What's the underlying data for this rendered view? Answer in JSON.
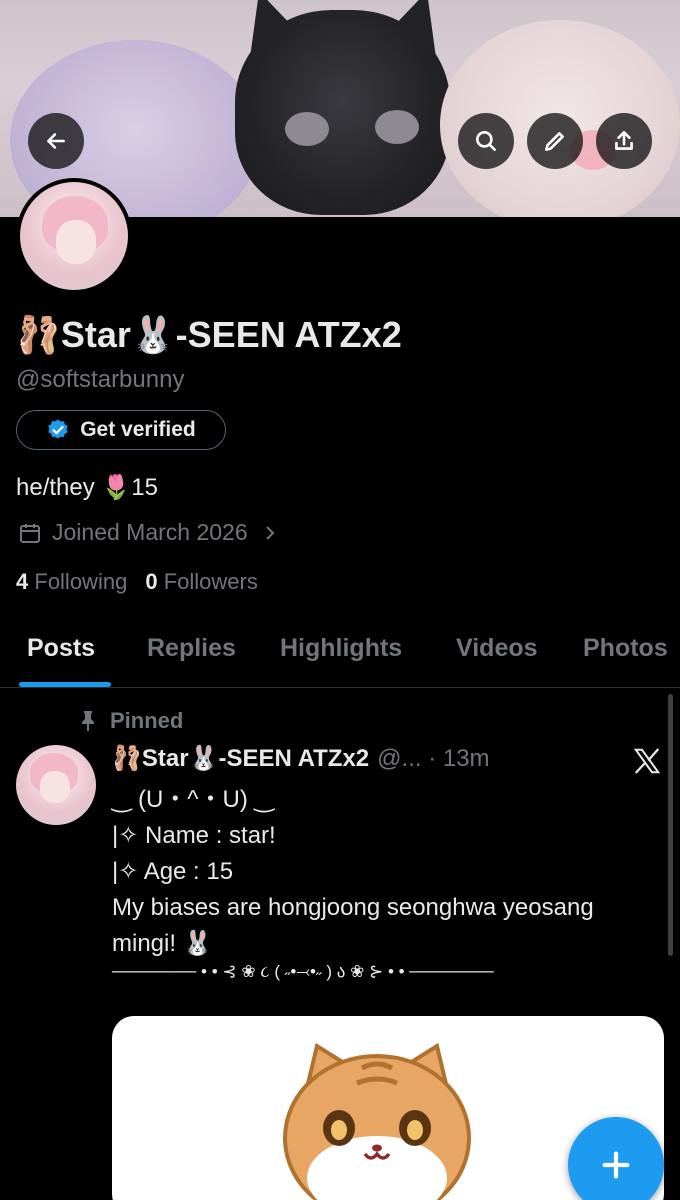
{
  "profile": {
    "display_name": "🩰Star🐰-SEEN ATZx2",
    "handle": "@softstarbunny",
    "get_verified_label": "Get verified",
    "bio": "he/they 🌷15",
    "joined": "Joined March 2026",
    "following_count": "4",
    "following_label": "Following",
    "followers_count": "0",
    "followers_label": "Followers"
  },
  "tabs": [
    {
      "label": "Posts",
      "active": true
    },
    {
      "label": "Replies",
      "active": false
    },
    {
      "label": "Highlights",
      "active": false
    },
    {
      "label": "Videos",
      "active": false
    },
    {
      "label": "Photos",
      "active": false
    }
  ],
  "pinned_post": {
    "pinned_label": "Pinned",
    "author_name": "🩰Star🐰-SEEN ATZx2",
    "author_meta": "@... · 13m",
    "lines": [
      "‿ (U・^・U) ‿",
      "|✧ Name : star!",
      "|✧ Age : 15",
      "My biases are hongjoong seonghwa yeosang mingi! 🐰"
    ],
    "divider": "─────── • • ⊰ ❀ ૮ ( ˶•⤙•˶ ) ა ❀ ⊱ • • ───────"
  },
  "colors": {
    "accent": "#1d9bf0",
    "background": "#000000",
    "text_primary": "#e7e9ea",
    "text_secondary": "#71767b"
  },
  "icons": [
    "back-arrow-icon",
    "search-icon",
    "pencil-icon",
    "share-icon",
    "verified-badge-icon",
    "calendar-icon",
    "chevron-right-icon",
    "pin-icon",
    "x-logo-icon",
    "plus-icon"
  ]
}
